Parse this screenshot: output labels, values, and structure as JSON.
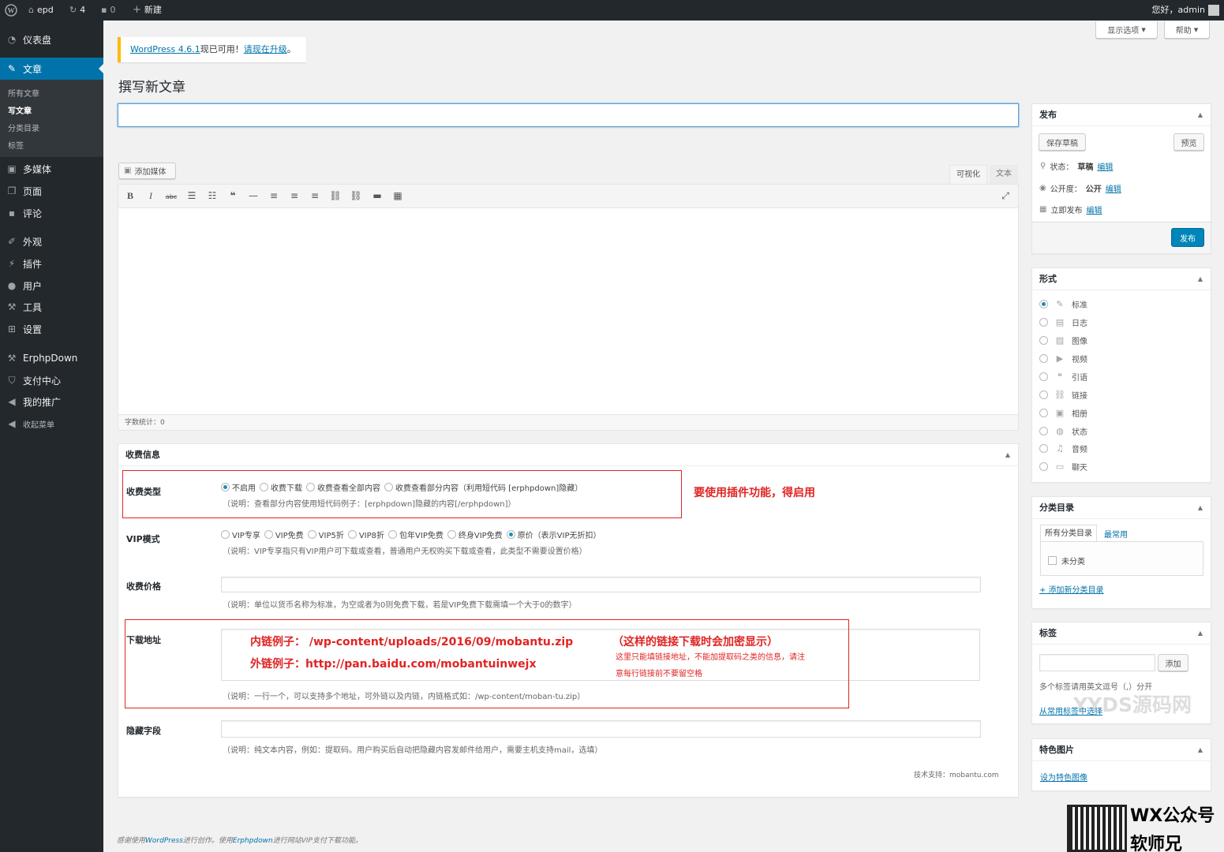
{
  "adminbar": {
    "site_name": "epd",
    "updates_count": "4",
    "comments_count": "0",
    "new_label": "新建",
    "greeting": "您好，admin"
  },
  "sidebar": {
    "items": [
      {
        "label": "仪表盘",
        "icon": "dashboard-icon"
      },
      {
        "label": "文章",
        "icon": "pin-icon"
      },
      {
        "label": "多媒体",
        "icon": "media-icon"
      },
      {
        "label": "页面",
        "icon": "page-icon"
      },
      {
        "label": "评论",
        "icon": "comment-icon"
      },
      {
        "label": "外观",
        "icon": "brush-icon"
      },
      {
        "label": "插件",
        "icon": "plugin-icon"
      },
      {
        "label": "用户",
        "icon": "user-icon"
      },
      {
        "label": "工具",
        "icon": "wrench-icon"
      },
      {
        "label": "设置",
        "icon": "settings-icon"
      },
      {
        "label": "ErphpDown",
        "icon": "wrench-icon"
      },
      {
        "label": "支付中心",
        "icon": "shield-icon"
      },
      {
        "label": "我的推广",
        "icon": "megaphone-icon"
      },
      {
        "label": "收起菜单",
        "icon": "collapse-icon"
      }
    ],
    "submenu": [
      "所有文章",
      "写文章",
      "分类目录",
      "标签"
    ]
  },
  "screen_options": "显示选项",
  "help": "帮助",
  "notice": {
    "link": "WordPress 4.6.1",
    "text": "现已可用！",
    "action": "请现在升级",
    "end": "。"
  },
  "page_title": "撰写新文章",
  "title_input_value": "",
  "editor": {
    "add_media": "添加媒体",
    "tab_visual": "可视化",
    "tab_text": "文本",
    "word_count": "字数统计：0"
  },
  "publish": {
    "title": "发布",
    "save_draft": "保存草稿",
    "preview": "预览",
    "status_label": "状态：",
    "status_value": "草稿",
    "visibility_label": "公开度：",
    "visibility_value": "公开",
    "schedule": "立即发布",
    "edit": "编辑",
    "publish_btn": "发布"
  },
  "format": {
    "title": "形式",
    "options": [
      {
        "label": "标准",
        "icon": "pin-icon",
        "checked": true
      },
      {
        "label": "日志",
        "icon": "aside-icon",
        "checked": false
      },
      {
        "label": "图像",
        "icon": "image-icon",
        "checked": false
      },
      {
        "label": "视频",
        "icon": "video-icon",
        "checked": false
      },
      {
        "label": "引语",
        "icon": "quote-icon",
        "checked": false
      },
      {
        "label": "链接",
        "icon": "link-icon",
        "checked": false
      },
      {
        "label": "相册",
        "icon": "gallery-icon",
        "checked": false
      },
      {
        "label": "状态",
        "icon": "status-icon",
        "checked": false
      },
      {
        "label": "音频",
        "icon": "audio-icon",
        "checked": false
      },
      {
        "label": "聊天",
        "icon": "chat-icon",
        "checked": false
      }
    ]
  },
  "categories": {
    "title": "分类目录",
    "tab_all": "所有分类目录",
    "tab_popular": "最常用",
    "item": "未分类",
    "add_new": "+ 添加新分类目录"
  },
  "tags": {
    "title": "标签",
    "add_btn": "添加",
    "hint": "多个标签请用英文逗号（,）分开",
    "choose": "从常用标签中选择"
  },
  "featured": {
    "title": "特色图片",
    "set": "设为特色图像"
  },
  "fee": {
    "title": "收费信息",
    "type_label": "收费类型",
    "type_options": [
      {
        "label": "不启用",
        "checked": true
      },
      {
        "label": "收费下载",
        "checked": false
      },
      {
        "label": "收费查看全部内容",
        "checked": false
      },
      {
        "label": "收费查看部分内容（利用短代码 [erphpdown]隐藏）",
        "checked": false
      }
    ],
    "type_desc": "（说明：查看部分内容使用短代码例子：[erphpdown]隐藏的内容[/erphpdown]）",
    "vip_label": "VIP模式",
    "vip_options": [
      {
        "label": "VIP专享",
        "checked": false
      },
      {
        "label": "VIP免费",
        "checked": false
      },
      {
        "label": "VIP5折",
        "checked": false
      },
      {
        "label": "VIP8折",
        "checked": false
      },
      {
        "label": "包年VIP免费",
        "checked": false
      },
      {
        "label": "终身VIP免费",
        "checked": false
      },
      {
        "label": "原价（表示VIP无折扣）",
        "checked": true
      }
    ],
    "vip_desc": "（说明：VIP专享指只有VIP用户可下载或查看，普通用户无权购买下载或查看，此类型不需要设置价格）",
    "price_label": "收费价格",
    "price_value": "",
    "price_desc": "（说明：单位以货币名称为标准，为空或者为0则免费下载，若是VIP免费下载需填一个大于0的数字）",
    "download_label": "下载地址",
    "download_desc": "（说明：一行一个，可以支持多个地址，可外链以及内链，内链格式如：/wp-content/moban-tu.zip）",
    "hidden_label": "隐藏字段",
    "hidden_value": "",
    "hidden_desc": "（说明：纯文本内容，例如：提取码。用户购买后自动把隐藏内容发邮件给用户，需要主机支持mail，选填）",
    "support": "技术支持：mobantu.com"
  },
  "annotations": {
    "enable_note": "要使用插件功能，得启用",
    "internal_example": "内链例子：  /wp-content/uploads/2016/09/mobantu.zip",
    "external_example": "外链例子：http://pan.baidu.com/mobantuinwejx",
    "encrypt_note": "（这样的链接下载时会加密显示）",
    "note_line1": "这里只能填链接地址，不能加提取码之类的信息，请注",
    "note_line2": "意每行链接前不要留空格"
  },
  "footer": {
    "thanks": "感谢使用",
    "wp": "WordPress",
    "mid": "进行创作。使用",
    "erphp": "Erphpdown",
    "tail": "进行网站VIP支付下载功能。"
  },
  "watermark": {
    "text": "YYDS源码网",
    "wx_line1": "WX公众号",
    "wx_line2": "软师兄"
  },
  "colors": {
    "admin_dark": "#23282d",
    "accent": "#0073aa",
    "annotation_red": "#e02424",
    "notice_yellow": "#ffb900"
  }
}
